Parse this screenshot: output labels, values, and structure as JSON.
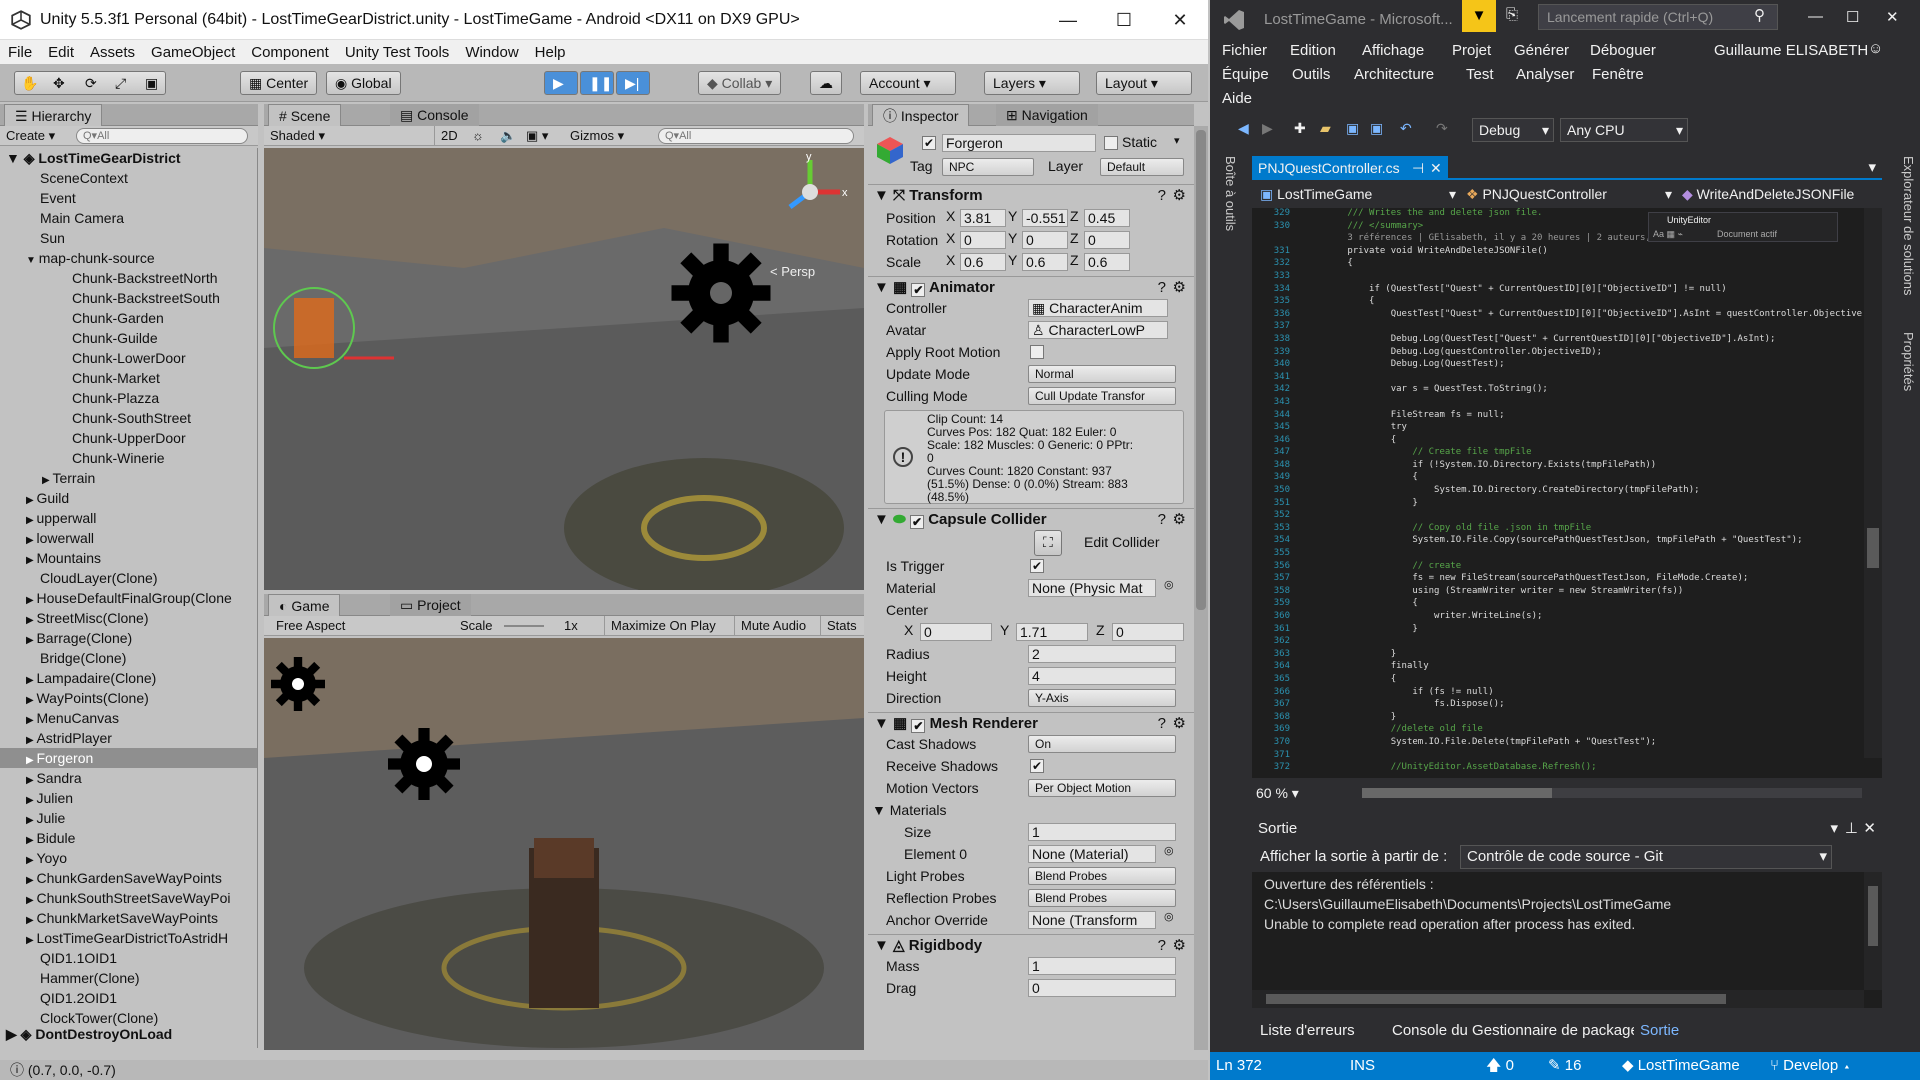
{
  "unity": {
    "title": "Unity 5.5.3f1 Personal (64bit) - LostTimeGearDistrict.unity - LostTimeGame - Android <DX11 on DX9 GPU>",
    "menu": [
      "File",
      "Edit",
      "Assets",
      "GameObject",
      "Component",
      "Unity Test Tools",
      "Window",
      "Help"
    ],
    "toolbar": {
      "center": "Center",
      "global": "Global",
      "collab": "Collab",
      "account": "Account",
      "layers": "Layers",
      "layout": "Layout"
    },
    "hierarchy": {
      "tab": "Hierarchy",
      "create": "Create",
      "search": "Q▾All",
      "root": "LostTimeGearDistrict",
      "rows": [
        {
          "t": "SceneContext",
          "i": 1
        },
        {
          "t": "Event",
          "i": 1
        },
        {
          "t": "Main Camera",
          "i": 1
        },
        {
          "t": "Sun",
          "i": 1
        },
        {
          "t": "map-chunk-source",
          "i": 1,
          "a": "▼"
        },
        {
          "t": "Chunk-BackstreetNorth",
          "i": 3
        },
        {
          "t": "Chunk-BackstreetSouth",
          "i": 3
        },
        {
          "t": "Chunk-Garden",
          "i": 3
        },
        {
          "t": "Chunk-Guilde",
          "i": 3
        },
        {
          "t": "Chunk-LowerDoor",
          "i": 3
        },
        {
          "t": "Chunk-Market",
          "i": 3
        },
        {
          "t": "Chunk-Plazza",
          "i": 3
        },
        {
          "t": "Chunk-SouthStreet",
          "i": 3
        },
        {
          "t": "Chunk-UpperDoor",
          "i": 3
        },
        {
          "t": "Chunk-Winerie",
          "i": 3
        },
        {
          "t": "Terrain",
          "i": 2,
          "a": "▶"
        },
        {
          "t": "Guild",
          "i": 1,
          "a": "▶"
        },
        {
          "t": "upperwall",
          "i": 1,
          "a": "▶"
        },
        {
          "t": "lowerwall",
          "i": 1,
          "a": "▶"
        },
        {
          "t": "Mountains",
          "i": 1,
          "a": "▶"
        },
        {
          "t": "CloudLayer(Clone)",
          "i": 1
        },
        {
          "t": "HouseDefaultFinalGroup(Clone",
          "i": 1,
          "a": "▶"
        },
        {
          "t": "StreetMisc(Clone)",
          "i": 1,
          "a": "▶"
        },
        {
          "t": "Barrage(Clone)",
          "i": 1,
          "a": "▶"
        },
        {
          "t": "Bridge(Clone)",
          "i": 1
        },
        {
          "t": "Lampadaire(Clone)",
          "i": 1,
          "a": "▶"
        },
        {
          "t": "WayPoints(Clone)",
          "i": 1,
          "a": "▶"
        },
        {
          "t": "MenuCanvas",
          "i": 1,
          "a": "▶"
        },
        {
          "t": "AstridPlayer",
          "i": 1,
          "a": "▶"
        },
        {
          "t": "Forgeron",
          "i": 1,
          "a": "▶",
          "sel": true
        },
        {
          "t": "Sandra",
          "i": 1,
          "a": "▶"
        },
        {
          "t": "Julien",
          "i": 1,
          "a": "▶"
        },
        {
          "t": "Julie",
          "i": 1,
          "a": "▶"
        },
        {
          "t": "Bidule",
          "i": 1,
          "a": "▶"
        },
        {
          "t": "Yoyo",
          "i": 1,
          "a": "▶"
        },
        {
          "t": "ChunkGardenSaveWayPoints",
          "i": 1,
          "a": "▶"
        },
        {
          "t": "ChunkSouthStreetSaveWayPoi",
          "i": 1,
          "a": "▶"
        },
        {
          "t": "ChunkMarketSaveWayPoints",
          "i": 1,
          "a": "▶"
        },
        {
          "t": "LostTimeGearDistrictToAstridH",
          "i": 1,
          "a": "▶"
        },
        {
          "t": "QID1.1OID1",
          "i": 1
        },
        {
          "t": "Hammer(Clone)",
          "i": 1
        },
        {
          "t": "QID1.2OID1",
          "i": 1
        },
        {
          "t": "ClockTower(Clone)",
          "i": 1
        }
      ],
      "dontdestroy": "DontDestroyOnLoad"
    },
    "scene": {
      "tab": "Scene",
      "console": "Console",
      "shaded": "Shaded",
      "mode2d": "2D",
      "gizmos": "Gizmos",
      "search": "Q▾All",
      "persp": "< Persp"
    },
    "game": {
      "tab": "Game",
      "project": "Project",
      "aspect": "Free Aspect",
      "scale": "Scale",
      "scale_val": "1x",
      "maximize": "Maximize On Play",
      "mute": "Mute Audio",
      "stats": "Stats"
    },
    "inspector": {
      "tab": "Inspector",
      "nav": "Navigation",
      "name": "Forgeron",
      "static": "Static",
      "tag_label": "Tag",
      "tag": "NPC",
      "layer_label": "Layer",
      "layer": "Default",
      "transform": {
        "title": "Transform",
        "pos": [
          "3.81",
          "-0.551",
          "0.45"
        ],
        "rot": [
          "0",
          "0",
          "0"
        ],
        "scale": [
          "0.6",
          "0.6",
          "0.6"
        ],
        "labels": [
          "Position",
          "Rotation",
          "Scale"
        ]
      },
      "animator": {
        "title": "Animator",
        "controller": "CharacterAnim",
        "avatar": "CharacterLowP",
        "update": "Normal",
        "culling": "Cull Update Transfor",
        "labels": [
          "Controller",
          "Avatar",
          "Apply Root Motion",
          "Update Mode",
          "Culling Mode"
        ],
        "info": "Clip Count: 14\nCurves Pos: 182 Quat: 182 Euler: 0\nScale: 182 Muscles: 0 Generic: 0 PPtr:\n0\nCurves Count: 1820 Constant: 937\n(51.5%) Dense: 0 (0.0%) Stream: 883\n(48.5%)"
      },
      "capsule": {
        "title": "Capsule Collider",
        "edit": "Edit Collider",
        "material": "None (Physic Mat",
        "center": [
          "0",
          "1.71",
          "0"
        ],
        "radius": "2",
        "height": "4",
        "direction": "Y-Axis",
        "labels": [
          "Is Trigger",
          "Material",
          "Center",
          "Radius",
          "Height",
          "Direction"
        ]
      },
      "mesh": {
        "title": "Mesh Renderer",
        "cast": "On",
        "motion": "Per Object Motion",
        "size": "1",
        "element": "None (Material)",
        "light": "Blend Probes",
        "reflection": "Blend Probes",
        "anchor": "None (Transform",
        "labels": [
          "Cast Shadows",
          "Receive Shadows",
          "Motion Vectors",
          "Materials",
          "Size",
          "Element 0",
          "Light Probes",
          "Reflection Probes",
          "Anchor Override"
        ]
      },
      "rigid": {
        "title": "Rigidbody",
        "mass": "1",
        "drag": "0",
        "labels": [
          "Mass",
          "Drag"
        ]
      }
    },
    "status": "(0.7, 0.0, -0.7)"
  },
  "vs": {
    "title": "LostTimeGame - Microsoft...",
    "quicklaunch": "Lancement rapide (Ctrl+Q)",
    "menu": [
      "Fichier",
      "Edition",
      "Affichage",
      "Projet",
      "Générer",
      "Déboguer",
      "Équipe",
      "Outils",
      "Architecture",
      "Test",
      "Analyser",
      "Fenêtre",
      "Aide"
    ],
    "user": "Guillaume ELISABETH",
    "config": "Debug",
    "platform": "Any CPU",
    "file_tab": "PNJQuestController.cs",
    "nav": [
      "LostTimeGame",
      "PNJQuestController",
      "WriteAndDeleteJSONFile"
    ],
    "side_left": "Boîte à outils",
    "side_right": [
      "Explorateur de solutions",
      "Propriétés"
    ],
    "mini": {
      "label": "UnityEditor",
      "doc": "Document actif"
    },
    "zoom": "60 %",
    "lines": [
      "329",
      "330",
      "",
      "331",
      "332",
      "333",
      "334",
      "335",
      "336",
      "337",
      "338",
      "339",
      "340",
      "341",
      "342",
      "343",
      "344",
      "345",
      "346",
      "347",
      "348",
      "349",
      "350",
      "351",
      "352",
      "353",
      "354",
      "355",
      "356",
      "357",
      "358",
      "359",
      "360",
      "361",
      "362",
      "363",
      "364",
      "365",
      "366",
      "367",
      "368",
      "369",
      "370",
      "371",
      "372"
    ],
    "code": [
      "        /// Writes the and delete json file.",
      "        /// </summary>",
      "        3 références | GElisabeth, il y a 20 heures | 2 auteurs, 7 modifications",
      "        private void WriteAndDeleteJSONFile()",
      "        {",
      "",
      "            if (QuestTest[\"Quest\" + CurrentQuestID][0][\"ObjectiveID\"] != null)",
      "            {",
      "                QuestTest[\"Quest\" + CurrentQuestID][0][\"ObjectiveID\"].AsInt = questController.Objective",
      "",
      "                Debug.Log(QuestTest[\"Quest\" + CurrentQuestID][0][\"ObjectiveID\"].AsInt);",
      "                Debug.Log(questController.ObjectiveID);",
      "                Debug.Log(QuestTest);",
      "",
      "                var s = QuestTest.ToString();",
      "",
      "                FileStream fs = null;",
      "                try",
      "                {",
      "                    // Create file tmpFile",
      "                    if (!System.IO.Directory.Exists(tmpFilePath))",
      "                    {",
      "                        System.IO.Directory.CreateDirectory(tmpFilePath);",
      "                    }",
      "",
      "                    // Copy old file .json in tmpFile",
      "                    System.IO.File.Copy(sourcePathQuestTestJson, tmpFilePath + \"QuestTest\");",
      "",
      "                    // create",
      "                    fs = new FileStream(sourcePathQuestTestJson, FileMode.Create);",
      "                    using (StreamWriter writer = new StreamWriter(fs))",
      "                    {",
      "                        writer.WriteLine(s);",
      "                    }",
      "",
      "                }",
      "                finally",
      "                {",
      "                    if (fs != null)",
      "                        fs.Dispose();",
      "                }",
      "                //delete old file",
      "                System.IO.File.Delete(tmpFilePath + \"QuestTest\");",
      "",
      "                //UnityEditor.AssetDatabase.Refresh();"
    ],
    "output": {
      "title": "Sortie",
      "from_label": "Afficher la sortie à partir de :",
      "from": "Contrôle de code source - Git",
      "lines": [
        "Ouverture des référentiels :",
        "C:\\Users\\GuillaumeElisabeth\\Documents\\Projects\\LostTimeGame",
        "Unable to complete read operation after process has exited."
      ]
    },
    "bottom_tabs": [
      "Liste d'erreurs",
      "Console du Gestionnaire de package",
      "Sortie"
    ],
    "status": {
      "ln": "Ln 372",
      "ins": "INS",
      "up": "0",
      "edits": "16",
      "repo": "LostTimeGame",
      "branch": "Develop"
    }
  }
}
